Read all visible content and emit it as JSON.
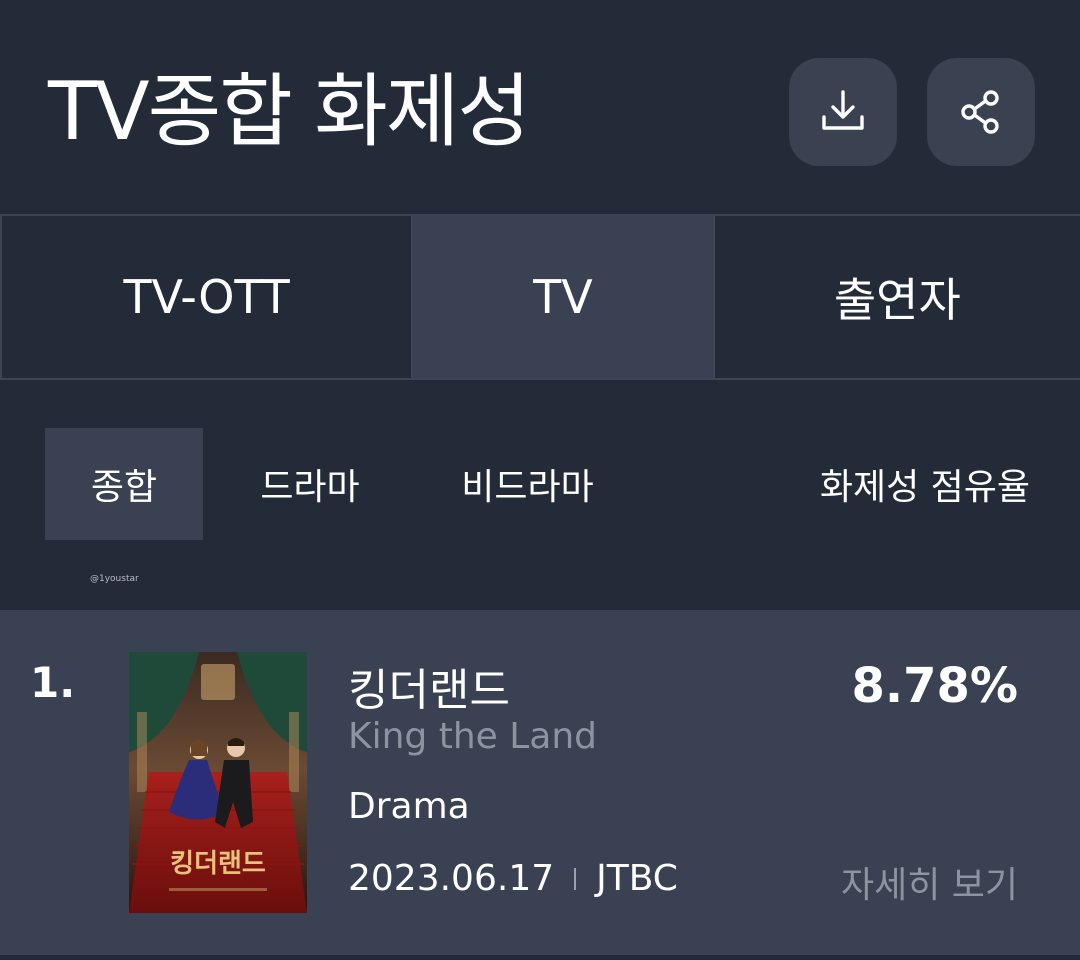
{
  "header": {
    "title": "TV종합 화제성",
    "download_icon": "download-icon",
    "share_icon": "share-icon"
  },
  "tabs": [
    {
      "label": "TV-OTT",
      "active": false
    },
    {
      "label": "TV",
      "active": true
    },
    {
      "label": "출연자",
      "active": false
    }
  ],
  "subtabs": [
    {
      "label": "종합",
      "active": true
    },
    {
      "label": "드라마",
      "active": false
    },
    {
      "label": "비드라마",
      "active": false
    },
    {
      "label": "화제성 점유율",
      "active": false
    }
  ],
  "watermark": "@1youstar",
  "ranking": [
    {
      "rank": "1.",
      "title": "킹더랜드",
      "subtitle": "King the Land",
      "genre": "Drama",
      "date": "2023.06.17",
      "network": "JTBC",
      "score": "8.78%",
      "detail_label": "자세히 보기",
      "poster_title": "킹더랜드"
    }
  ],
  "colors": {
    "background": "#232a38",
    "active_tab": "#394152",
    "card": "#394152",
    "muted_text": "#8c93a1"
  }
}
